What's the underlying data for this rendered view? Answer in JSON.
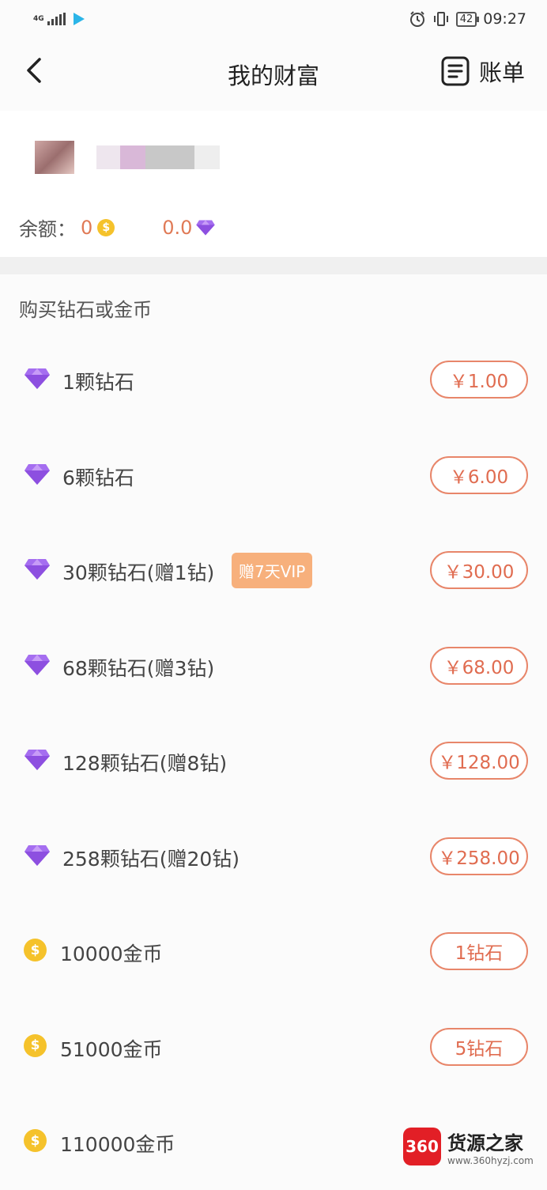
{
  "status_bar": {
    "network": "4G",
    "battery": "42",
    "time": "09:27"
  },
  "header": {
    "title": "我的财富",
    "bill_label": "账单"
  },
  "balance": {
    "label": "余额：",
    "coins": "0",
    "diamonds": "0.0"
  },
  "section": {
    "title": "购买钻石或金币"
  },
  "items": [
    {
      "icon": "diamond-icon",
      "label": "1颗钻石",
      "price": "￥1.00"
    },
    {
      "icon": "diamond-icon",
      "label": "6颗钻石",
      "price": "￥6.00"
    },
    {
      "icon": "diamond-icon",
      "label": "30颗钻石(赠1钻)",
      "tag": "赠7天VIP",
      "price": "￥30.00"
    },
    {
      "icon": "diamond-icon",
      "label": "68颗钻石(赠3钻)",
      "price": "￥68.00"
    },
    {
      "icon": "diamond-icon",
      "label": "128颗钻石(赠8钻)",
      "price": "￥128.00"
    },
    {
      "icon": "diamond-icon",
      "label": "258颗钻石(赠20钻)",
      "price": "￥258.00"
    },
    {
      "icon": "coin-icon",
      "label": "10000金币",
      "price": "1钻石"
    },
    {
      "icon": "coin-icon",
      "label": "51000金币",
      "price": "5钻石"
    },
    {
      "icon": "coin-icon",
      "label": "110000金币",
      "price": ""
    }
  ],
  "coin_symbol": "$",
  "watermark": {
    "logo": "360",
    "title": "货源之家",
    "url": "www.360hyzj.com"
  },
  "colors": {
    "accent": "#e06c50",
    "diamond": "#9b5de5",
    "coin": "#f5c22b",
    "tag": "#f7b07c"
  }
}
